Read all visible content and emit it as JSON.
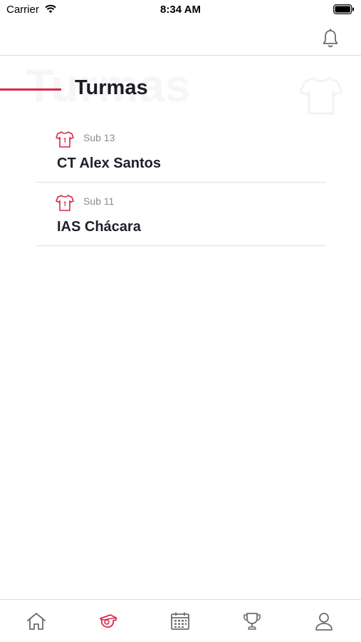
{
  "status_bar": {
    "carrier": "Carrier",
    "time": "8:34 AM"
  },
  "header": {
    "notification_icon": "bell-icon"
  },
  "title": {
    "text": "Turmas",
    "watermark": "Turmas"
  },
  "classes": [
    {
      "category": "Sub 13",
      "name": "CT Alex Santos",
      "icon": "shirt-icon"
    },
    {
      "category": "Sub 11",
      "name": "IAS Chácara",
      "icon": "shirt-icon"
    }
  ],
  "tab_bar": {
    "tabs": [
      {
        "icon": "home-icon",
        "active": false
      },
      {
        "icon": "whistle-icon",
        "active": true
      },
      {
        "icon": "calendar-icon",
        "active": false
      },
      {
        "icon": "trophy-icon",
        "active": false
      },
      {
        "icon": "profile-icon",
        "active": false
      }
    ]
  },
  "colors": {
    "accent": "#d9264b",
    "text_dark": "#1c1c24",
    "text_muted": "#8a8a92",
    "divider": "#dde0ec",
    "icon_gray": "#6b6b72"
  }
}
